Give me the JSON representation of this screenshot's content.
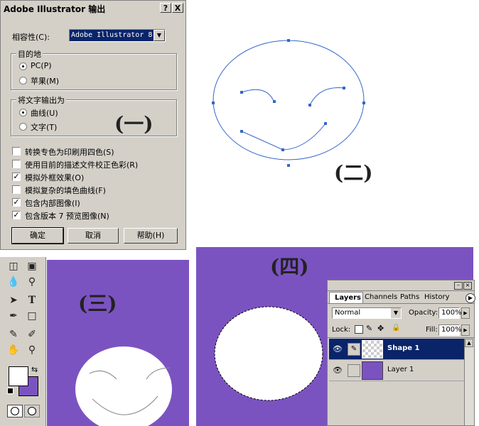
{
  "markers": {
    "one": "(一)",
    "two": "(二)",
    "three": "(三)",
    "four": "(四)"
  },
  "dialog": {
    "title": "Adobe Illustrator 输出",
    "help_btn": "?",
    "close_btn": "X",
    "compat_label": "相容性(C):",
    "compat_value": "Adobe Illustrator 8",
    "dest_group": "目的地",
    "dest_pc": "PC(P)",
    "dest_mac": "苹果(M)",
    "text_group": "将文字输出为",
    "text_curves": "曲线(U)",
    "text_text": "文字(T)",
    "options": [
      {
        "label": "转换专色为印刷用四色(S)",
        "checked": false
      },
      {
        "label": "使用目前的描述文件校正色彩(R)",
        "checked": false
      },
      {
        "label": "模拟外框效果(O)",
        "checked": true
      },
      {
        "label": "模拟复杂的填色曲线(F)",
        "checked": false
      },
      {
        "label": "包含内部图像(I)",
        "checked": true
      },
      {
        "label": "包含版本 7 预览图像(N)",
        "checked": true
      }
    ],
    "ok": "确定",
    "cancel": "取消",
    "help": "帮助(H)"
  },
  "toolbox": {
    "icons": [
      "eraser-icon",
      "gradient-icon",
      "blur-icon",
      "dodge-icon",
      "path-select-icon",
      "type-icon",
      "pen-icon",
      "rectangle-icon",
      "notes-icon",
      "eyedropper-icon",
      "hand-icon",
      "zoom-icon"
    ]
  },
  "layers": {
    "tabs": [
      "Layers",
      "Channels",
      "Paths",
      "History"
    ],
    "blend_mode": "Normal",
    "opacity_label": "Opacity:",
    "opacity_value": "100%",
    "lock_label": "Lock:",
    "fill_label": "Fill:",
    "fill_value": "100%",
    "rows": [
      {
        "name": "Shape 1",
        "selected": true
      },
      {
        "name": "Layer 1",
        "selected": false
      }
    ]
  },
  "colors": {
    "purple": "#7b53c1",
    "selection": "#0a246a",
    "dialog_bg": "#d4d0c8",
    "path_blue": "#3366cc"
  }
}
